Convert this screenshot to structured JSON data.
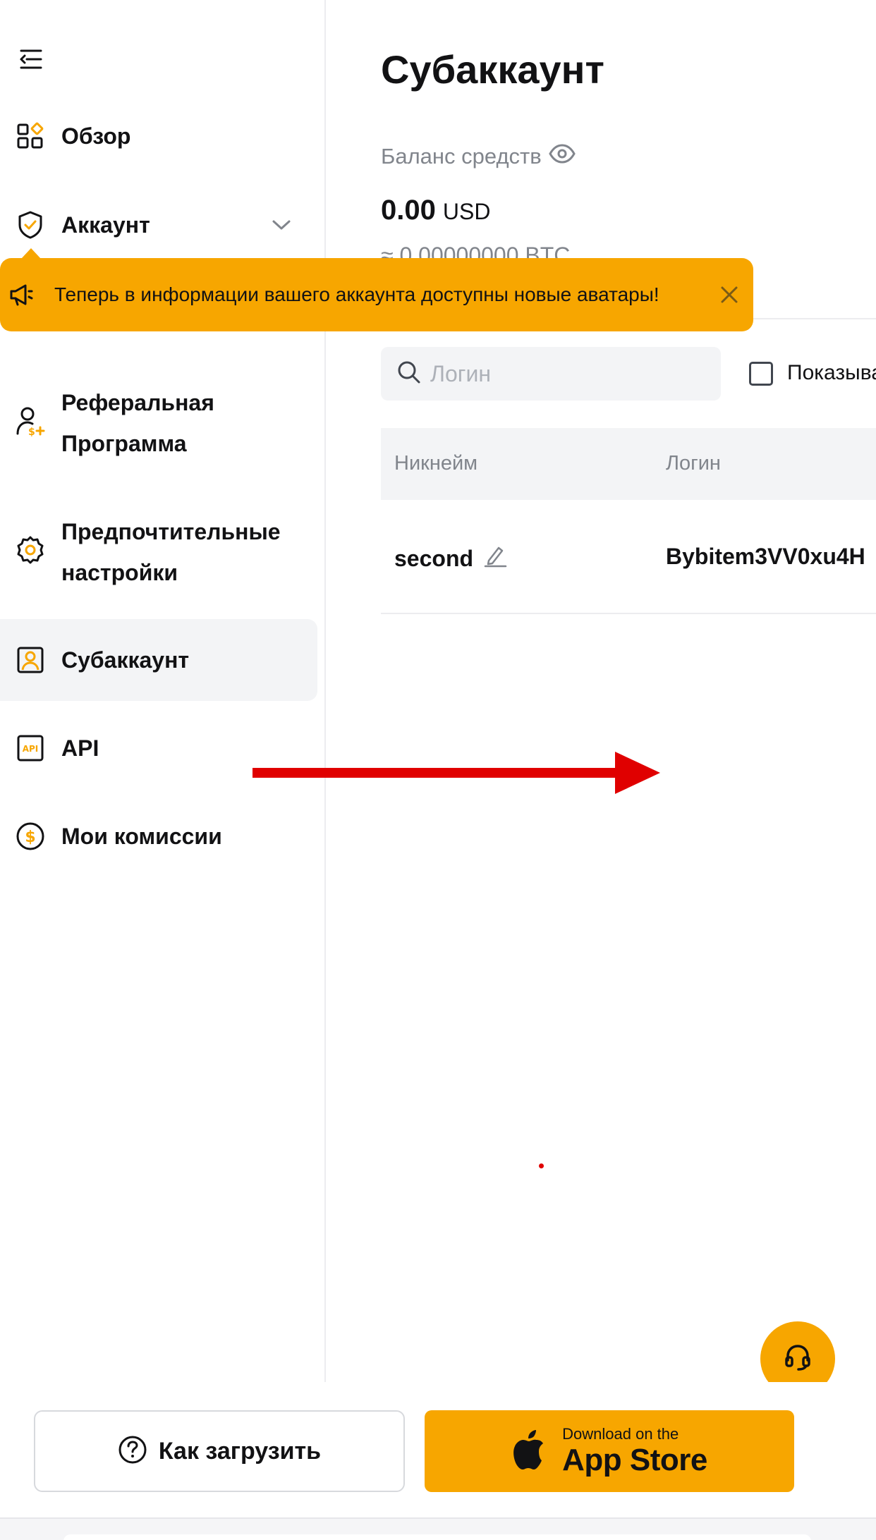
{
  "sidebar": {
    "items": [
      {
        "label": "Обзор",
        "icon": "overview-icon"
      },
      {
        "label": "Аккаунт",
        "icon": "shield-check-icon"
      },
      {
        "label": "Реферальная",
        "label2": "Программа",
        "icon": "referral-icon"
      },
      {
        "label": "Предпочтительные",
        "label2": "настройки",
        "icon": "gear-icon"
      },
      {
        "label": "Субаккаунт",
        "icon": "subaccount-icon"
      },
      {
        "label": "API",
        "icon": "api-icon"
      },
      {
        "label": "Мои комиссии",
        "icon": "dollar-coin-icon"
      }
    ],
    "api_icon_text": "API",
    "active_item": "Субаккаунт"
  },
  "banner": {
    "text": "Теперь в информации вашего аккаунта доступны новые аватары!"
  },
  "main": {
    "title": "Субаккаунт",
    "balance_label": "Баланс средств",
    "balance_amount": "0.00",
    "balance_currency": "USD",
    "balance_btc": "≈ 0.00000000 BTC",
    "search_placeholder": "Логин",
    "checkbox_label": "Показывать",
    "table": {
      "columns": [
        "Никнейм",
        "Логин"
      ],
      "rows": [
        {
          "nickname": "second",
          "login": "Bybitem3VV0xu4H"
        }
      ]
    }
  },
  "bottom": {
    "how_to_label": "Как загрузить",
    "store_small": "Download on the",
    "store_big": "App Store"
  },
  "colors": {
    "accent": "#f7a600",
    "annotation": "#e00000"
  }
}
